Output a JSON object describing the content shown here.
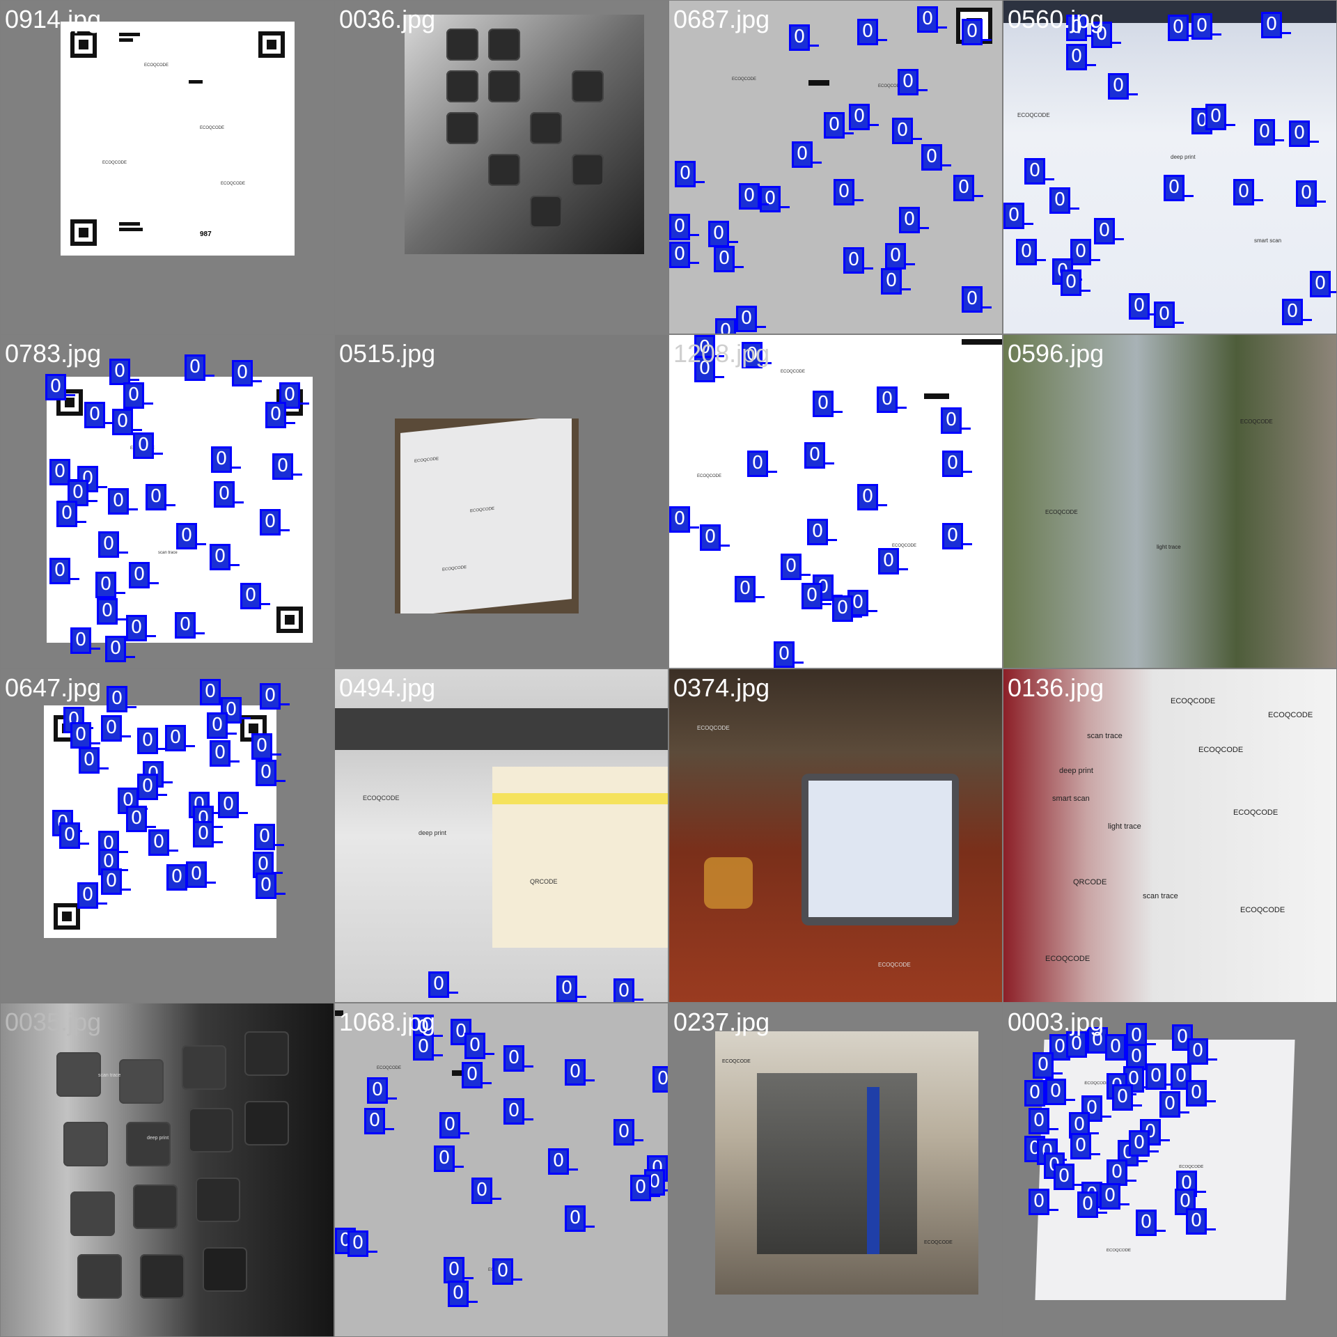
{
  "tiles": [
    {
      "label": "0914.jpg"
    },
    {
      "label": "0036.jpg"
    },
    {
      "label": "0687.jpg"
    },
    {
      "label": "0560.jpg"
    },
    {
      "label": "0783.jpg"
    },
    {
      "label": "0515.jpg"
    },
    {
      "label": "1208.jpg"
    },
    {
      "label": "0596.jpg"
    },
    {
      "label": "0647.jpg"
    },
    {
      "label": "0494.jpg"
    },
    {
      "label": "0374.jpg"
    },
    {
      "label": "0136.jpg"
    },
    {
      "label": "0035.jpg"
    },
    {
      "label": "1068.jpg"
    },
    {
      "label": "0237.jpg"
    },
    {
      "label": "0003.jpg"
    }
  ],
  "box_label": "0",
  "sample_text": {
    "a": "ECOQCODE",
    "b": "deep print",
    "c": "light trace",
    "d": "smart scan",
    "e": "scan trace",
    "f": "QRCODE",
    "num987": "987"
  },
  "colors": {
    "background": "#7f7f7f",
    "box_fill": "#1a2fd6",
    "box_border": "#0000ff",
    "label_text": "#ffffff"
  }
}
